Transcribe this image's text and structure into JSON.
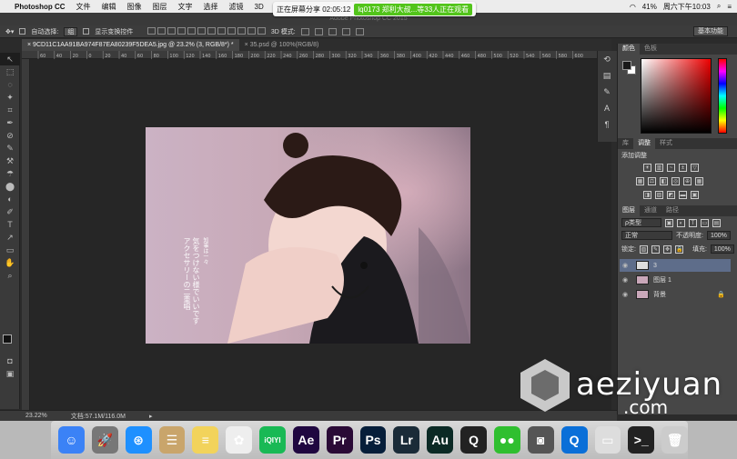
{
  "menubar": {
    "apple": "",
    "app_name": "Photoshop CC",
    "items": [
      "文件",
      "编辑",
      "图像",
      "图层",
      "文字",
      "选择",
      "滤镜",
      "3D"
    ],
    "battery": "41%",
    "clock": "周六下午10:03"
  },
  "share_banner": {
    "text": "正在屏幕分享 02:05:12",
    "viewers": "lq0173 郑利大叔...等33人正在观看"
  },
  "title_ghost": "Adobe Photoshop CC 2015",
  "options_bar": {
    "auto_select_label": "自动选择:",
    "auto_select_value": "组",
    "show_transform": "显示变换控件",
    "mode_3d": "3D 模式:",
    "workspace": "基本功能"
  },
  "tabs": [
    {
      "label": "9CD11C1AA91BA974F87EA80239F5DEA5.jpg @ 23.2% (3, RGB/8*) *"
    },
    {
      "label": "35.psd @ 100%(RGB/8)"
    }
  ],
  "ruler_labels": [
    "60",
    "40",
    "20",
    "0",
    "20",
    "40",
    "60",
    "80",
    "100",
    "120",
    "140",
    "160",
    "180",
    "200",
    "220",
    "240",
    "260",
    "280",
    "300",
    "320",
    "340",
    "360",
    "380",
    "400",
    "420",
    "440",
    "460",
    "480",
    "500",
    "520",
    "540",
    "560",
    "580",
    "600"
  ],
  "tools": [
    "↖",
    "⬚",
    "◌",
    "✦",
    "⌗",
    "✒",
    "⊘",
    "✎",
    "⚒",
    "☂",
    "⬤",
    "◐",
    "✐",
    "T",
    "↗",
    "▭",
    "✋",
    "⌕"
  ],
  "image_text": [
    "知事は一々",
    "気をつけない様でいいです",
    "アクセサリーの二重唱"
  ],
  "status": {
    "zoom": "23.22%",
    "doc": "文档:57.1M/116.0M"
  },
  "panels": {
    "color_tabs": [
      "颜色",
      "色板"
    ],
    "color_accent": "#e00000",
    "adj_tabs": [
      "库",
      "调整",
      "样式"
    ],
    "adj_label": "添加调整",
    "layer_tabs": [
      "图层",
      "通道",
      "路径"
    ],
    "kind_select": "ρ类型",
    "blend_mode": "正常",
    "opacity_label": "不透明度:",
    "opacity_value": "100%",
    "lock_label": "锁定:",
    "fill_label": "填充:",
    "fill_value": "100%",
    "layers": [
      {
        "name": "3",
        "selected": true
      },
      {
        "name": "图层 1",
        "selected": false
      },
      {
        "name": "背景",
        "selected": false
      }
    ]
  },
  "watermark": {
    "brand": "aeziyuan",
    "tld": ".com"
  },
  "dock": [
    {
      "name": "finder",
      "label": "☺",
      "color": "#3b82f6"
    },
    {
      "name": "launchpad",
      "label": "🚀",
      "color": "#777"
    },
    {
      "name": "safari",
      "label": "⊛",
      "color": "#1e90ff"
    },
    {
      "name": "contacts",
      "label": "☰",
      "color": "#c9a56b"
    },
    {
      "name": "notes",
      "label": "≡",
      "color": "#f2d35b"
    },
    {
      "name": "photos",
      "label": "✿",
      "color": "#eee"
    },
    {
      "name": "iqiyi",
      "label": "iQIYI",
      "color": "#19b955"
    },
    {
      "name": "after-effects",
      "label": "Ae",
      "color": "#1f0740"
    },
    {
      "name": "premiere",
      "label": "Pr",
      "color": "#2a0a36"
    },
    {
      "name": "photoshop",
      "label": "Ps",
      "color": "#061e3a"
    },
    {
      "name": "lightroom",
      "label": "Lr",
      "color": "#1a2b38"
    },
    {
      "name": "audition",
      "label": "Au",
      "color": "#0b2a25"
    },
    {
      "name": "qq",
      "label": "Q",
      "color": "#222"
    },
    {
      "name": "wechat",
      "label": "●●",
      "color": "#2fbf2f"
    },
    {
      "name": "screenshot",
      "label": "◙",
      "color": "#555"
    },
    {
      "name": "quicktime",
      "label": "Q",
      "color": "#0a6fd8"
    },
    {
      "name": "preview",
      "label": "▭",
      "color": "#ddd"
    },
    {
      "name": "terminal",
      "label": ">_",
      "color": "#222"
    },
    {
      "name": "trash",
      "label": "🗑",
      "color": "#ccc"
    }
  ]
}
